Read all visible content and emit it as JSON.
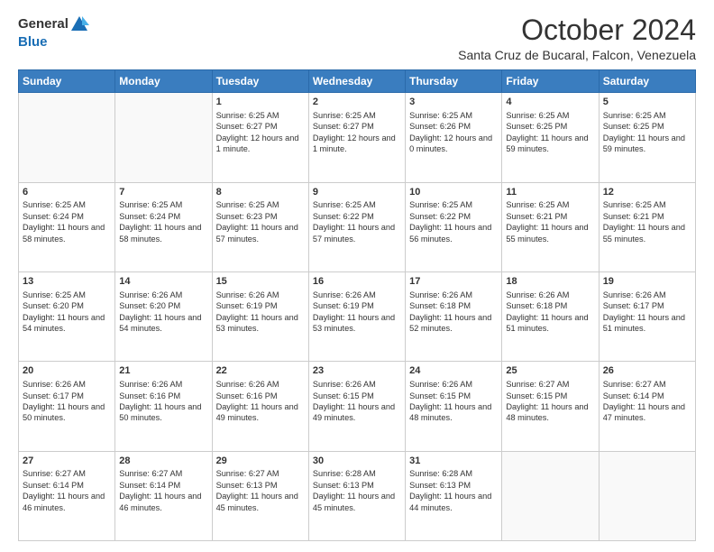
{
  "header": {
    "logo_line1": "General",
    "logo_line2": "Blue",
    "month": "October 2024",
    "location": "Santa Cruz de Bucaral, Falcon, Venezuela"
  },
  "columns": [
    "Sunday",
    "Monday",
    "Tuesday",
    "Wednesday",
    "Thursday",
    "Friday",
    "Saturday"
  ],
  "weeks": [
    [
      {
        "day": "",
        "text": ""
      },
      {
        "day": "",
        "text": ""
      },
      {
        "day": "1",
        "text": "Sunrise: 6:25 AM\nSunset: 6:27 PM\nDaylight: 12 hours\nand 1 minute."
      },
      {
        "day": "2",
        "text": "Sunrise: 6:25 AM\nSunset: 6:27 PM\nDaylight: 12 hours\nand 1 minute."
      },
      {
        "day": "3",
        "text": "Sunrise: 6:25 AM\nSunset: 6:26 PM\nDaylight: 12 hours\nand 0 minutes."
      },
      {
        "day": "4",
        "text": "Sunrise: 6:25 AM\nSunset: 6:25 PM\nDaylight: 11 hours\nand 59 minutes."
      },
      {
        "day": "5",
        "text": "Sunrise: 6:25 AM\nSunset: 6:25 PM\nDaylight: 11 hours\nand 59 minutes."
      }
    ],
    [
      {
        "day": "6",
        "text": "Sunrise: 6:25 AM\nSunset: 6:24 PM\nDaylight: 11 hours\nand 58 minutes."
      },
      {
        "day": "7",
        "text": "Sunrise: 6:25 AM\nSunset: 6:24 PM\nDaylight: 11 hours\nand 58 minutes."
      },
      {
        "day": "8",
        "text": "Sunrise: 6:25 AM\nSunset: 6:23 PM\nDaylight: 11 hours\nand 57 minutes."
      },
      {
        "day": "9",
        "text": "Sunrise: 6:25 AM\nSunset: 6:22 PM\nDaylight: 11 hours\nand 57 minutes."
      },
      {
        "day": "10",
        "text": "Sunrise: 6:25 AM\nSunset: 6:22 PM\nDaylight: 11 hours\nand 56 minutes."
      },
      {
        "day": "11",
        "text": "Sunrise: 6:25 AM\nSunset: 6:21 PM\nDaylight: 11 hours\nand 55 minutes."
      },
      {
        "day": "12",
        "text": "Sunrise: 6:25 AM\nSunset: 6:21 PM\nDaylight: 11 hours\nand 55 minutes."
      }
    ],
    [
      {
        "day": "13",
        "text": "Sunrise: 6:25 AM\nSunset: 6:20 PM\nDaylight: 11 hours\nand 54 minutes."
      },
      {
        "day": "14",
        "text": "Sunrise: 6:26 AM\nSunset: 6:20 PM\nDaylight: 11 hours\nand 54 minutes."
      },
      {
        "day": "15",
        "text": "Sunrise: 6:26 AM\nSunset: 6:19 PM\nDaylight: 11 hours\nand 53 minutes."
      },
      {
        "day": "16",
        "text": "Sunrise: 6:26 AM\nSunset: 6:19 PM\nDaylight: 11 hours\nand 53 minutes."
      },
      {
        "day": "17",
        "text": "Sunrise: 6:26 AM\nSunset: 6:18 PM\nDaylight: 11 hours\nand 52 minutes."
      },
      {
        "day": "18",
        "text": "Sunrise: 6:26 AM\nSunset: 6:18 PM\nDaylight: 11 hours\nand 51 minutes."
      },
      {
        "day": "19",
        "text": "Sunrise: 6:26 AM\nSunset: 6:17 PM\nDaylight: 11 hours\nand 51 minutes."
      }
    ],
    [
      {
        "day": "20",
        "text": "Sunrise: 6:26 AM\nSunset: 6:17 PM\nDaylight: 11 hours\nand 50 minutes."
      },
      {
        "day": "21",
        "text": "Sunrise: 6:26 AM\nSunset: 6:16 PM\nDaylight: 11 hours\nand 50 minutes."
      },
      {
        "day": "22",
        "text": "Sunrise: 6:26 AM\nSunset: 6:16 PM\nDaylight: 11 hours\nand 49 minutes."
      },
      {
        "day": "23",
        "text": "Sunrise: 6:26 AM\nSunset: 6:15 PM\nDaylight: 11 hours\nand 49 minutes."
      },
      {
        "day": "24",
        "text": "Sunrise: 6:26 AM\nSunset: 6:15 PM\nDaylight: 11 hours\nand 48 minutes."
      },
      {
        "day": "25",
        "text": "Sunrise: 6:27 AM\nSunset: 6:15 PM\nDaylight: 11 hours\nand 48 minutes."
      },
      {
        "day": "26",
        "text": "Sunrise: 6:27 AM\nSunset: 6:14 PM\nDaylight: 11 hours\nand 47 minutes."
      }
    ],
    [
      {
        "day": "27",
        "text": "Sunrise: 6:27 AM\nSunset: 6:14 PM\nDaylight: 11 hours\nand 46 minutes."
      },
      {
        "day": "28",
        "text": "Sunrise: 6:27 AM\nSunset: 6:14 PM\nDaylight: 11 hours\nand 46 minutes."
      },
      {
        "day": "29",
        "text": "Sunrise: 6:27 AM\nSunset: 6:13 PM\nDaylight: 11 hours\nand 45 minutes."
      },
      {
        "day": "30",
        "text": "Sunrise: 6:28 AM\nSunset: 6:13 PM\nDaylight: 11 hours\nand 45 minutes."
      },
      {
        "day": "31",
        "text": "Sunrise: 6:28 AM\nSunset: 6:13 PM\nDaylight: 11 hours\nand 44 minutes."
      },
      {
        "day": "",
        "text": ""
      },
      {
        "day": "",
        "text": ""
      }
    ]
  ]
}
